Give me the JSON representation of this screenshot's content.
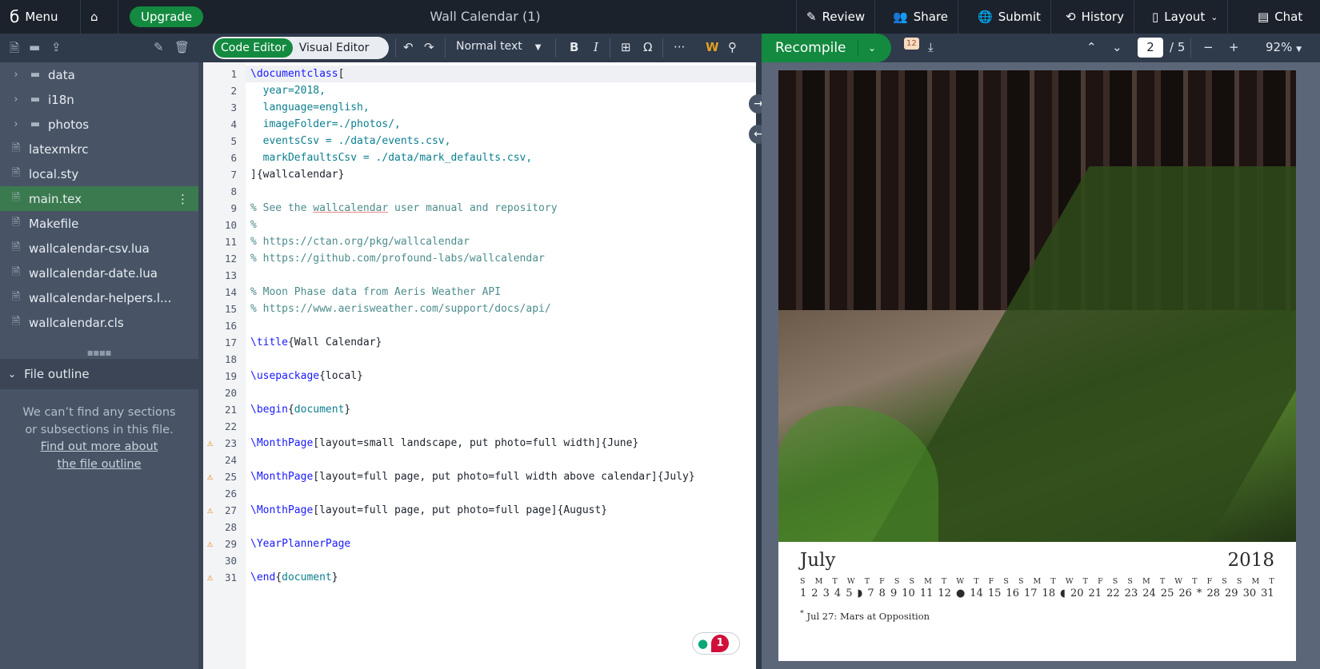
{
  "topbar": {
    "menu": "Menu",
    "upgrade": "Upgrade",
    "title": "Wall Calendar (1)",
    "review": "Review",
    "share": "Share",
    "submit": "Submit",
    "history": "History",
    "layout": "Layout",
    "chat": "Chat"
  },
  "toolbar": {
    "code_editor": "Code Editor",
    "visual_editor": "Visual Editor",
    "text_style": "Normal text",
    "bold": "B",
    "italic": "I",
    "omega": "Ω",
    "more": "···",
    "recompile": "Recompile",
    "log_count": "12",
    "page_current": "2",
    "page_total": "/ 5",
    "zoom": "92%"
  },
  "files": [
    {
      "name": "data",
      "type": "folder"
    },
    {
      "name": "i18n",
      "type": "folder"
    },
    {
      "name": "photos",
      "type": "folder"
    },
    {
      "name": "latexmkrc",
      "type": "file"
    },
    {
      "name": "local.sty",
      "type": "file"
    },
    {
      "name": "main.tex",
      "type": "file",
      "selected": true
    },
    {
      "name": "Makefile",
      "type": "file"
    },
    {
      "name": "wallcalendar-csv.lua",
      "type": "file"
    },
    {
      "name": "wallcalendar-date.lua",
      "type": "file"
    },
    {
      "name": "wallcalendar-helpers.l...",
      "type": "file"
    },
    {
      "name": "wallcalendar.cls",
      "type": "file"
    }
  ],
  "outline": {
    "title": "File outline",
    "message": "We can’t find any sections or subsections in this file.",
    "link": "Find out more about the file outline"
  },
  "code_lines": [
    {
      "n": "1",
      "html": "<span class='kw'>\\documentclass</span>["
    },
    {
      "n": "2",
      "html": "  <span class='arg'>year=2018,</span>"
    },
    {
      "n": "3",
      "html": "  <span class='arg'>language=english,</span>"
    },
    {
      "n": "4",
      "html": "  <span class='arg'>imageFolder=./photos/,</span>"
    },
    {
      "n": "5",
      "html": "  <span class='arg'>eventsCsv = ./data/events.csv,</span>"
    },
    {
      "n": "6",
      "html": "  <span class='arg'>markDefaultsCsv = ./data/mark_defaults.csv,</span>"
    },
    {
      "n": "7",
      "html": "]{wallcalendar}"
    },
    {
      "n": "8",
      "html": ""
    },
    {
      "n": "9",
      "html": "<span class='cm'>% See the <u style='text-decoration-color:#e88'>wallcalendar</u> user manual and repository</span>"
    },
    {
      "n": "10",
      "html": "<span class='cm'>%</span>"
    },
    {
      "n": "11",
      "html": "<span class='cm'>% https://ctan.org/pkg/wallcalendar</span>"
    },
    {
      "n": "12",
      "html": "<span class='cm'>% https://github.com/profound-labs/wallcalendar</span>"
    },
    {
      "n": "13",
      "html": ""
    },
    {
      "n": "14",
      "html": "<span class='cm'>% Moon Phase data from Aeris Weather API</span>"
    },
    {
      "n": "15",
      "html": "<span class='cm'>% https://www.aerisweather.com/support/docs/api/</span>"
    },
    {
      "n": "16",
      "html": ""
    },
    {
      "n": "17",
      "html": "<span class='kw'>\\title</span>{Wall Calendar}"
    },
    {
      "n": "18",
      "html": ""
    },
    {
      "n": "19",
      "html": "<span class='kw'>\\usepackage</span>{local}"
    },
    {
      "n": "20",
      "html": ""
    },
    {
      "n": "21",
      "html": "<span class='kw'>\\begin</span>{<span class='arg'>document</span>}"
    },
    {
      "n": "22",
      "html": ""
    },
    {
      "n": "23",
      "html": "<span class='kw'>\\MonthPage</span>[layout=small landscape, put photo=full width]{June}",
      "warn": true
    },
    {
      "n": "24",
      "html": ""
    },
    {
      "n": "25",
      "html": "<span class='kw'>\\MonthPage</span>[layout=full page, put photo=full width above calendar]{July}",
      "warn": true
    },
    {
      "n": "26",
      "html": ""
    },
    {
      "n": "27",
      "html": "<span class='kw'>\\MonthPage</span>[layout=full page, put photo=full page]{August}",
      "warn": true
    },
    {
      "n": "28",
      "html": ""
    },
    {
      "n": "29",
      "html": "<span class='kw'>\\YearPlannerPage</span>",
      "warn": true
    },
    {
      "n": "30",
      "html": ""
    },
    {
      "n": "31",
      "html": "<span class='kw'>\\end</span>{<span class='arg'>document</span>}",
      "warn": true
    }
  ],
  "review_badge": "1",
  "calendar": {
    "month": "July",
    "year": "2018",
    "weekdays": [
      "S",
      "M",
      "T",
      "W",
      "T",
      "F",
      "S",
      "S",
      "M",
      "T",
      "W",
      "T",
      "F",
      "S",
      "S",
      "M",
      "T",
      "W",
      "T",
      "F",
      "S",
      "S",
      "M",
      "T",
      "W",
      "T",
      "F",
      "S",
      "S",
      "M",
      "T"
    ],
    "days": [
      "1",
      "2",
      "3",
      "4",
      "5",
      "◗",
      "7",
      "8",
      "9",
      "10",
      "11",
      "12",
      "●",
      "14",
      "15",
      "16",
      "17",
      "18",
      "◖",
      "20",
      "21",
      "22",
      "23",
      "24",
      "25",
      "26",
      "*",
      "28",
      "29",
      "30",
      "31"
    ],
    "note": "Jul 27: Mars at Opposition"
  },
  "colors": {
    "accent": "#138a3f",
    "topbar": "#1b222c"
  }
}
